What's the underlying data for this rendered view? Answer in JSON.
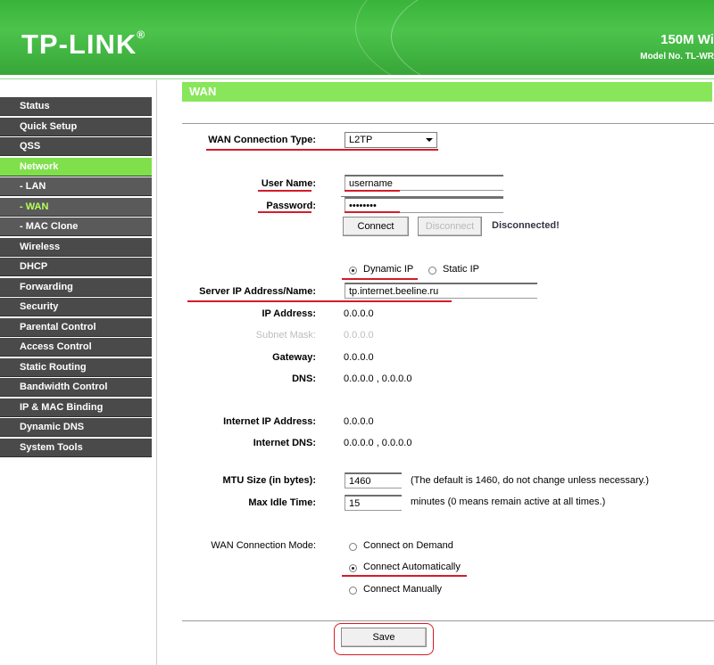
{
  "header": {
    "logo": "TP-LINK",
    "logo_mark": "®",
    "model_title": "150M Wi",
    "model_no": "Model No. TL-WR"
  },
  "sidebar": {
    "items": [
      {
        "label": "Status",
        "sub": false,
        "active": false
      },
      {
        "label": "Quick Setup",
        "sub": false,
        "active": false
      },
      {
        "label": "QSS",
        "sub": false,
        "active": false
      },
      {
        "label": "Network",
        "sub": false,
        "active": true
      },
      {
        "label": "- LAN",
        "sub": true,
        "active": false
      },
      {
        "label": "- WAN",
        "sub": true,
        "active": true
      },
      {
        "label": "- MAC Clone",
        "sub": true,
        "active": false
      },
      {
        "label": "Wireless",
        "sub": false,
        "active": false
      },
      {
        "label": "DHCP",
        "sub": false,
        "active": false
      },
      {
        "label": "Forwarding",
        "sub": false,
        "active": false
      },
      {
        "label": "Security",
        "sub": false,
        "active": false
      },
      {
        "label": "Parental Control",
        "sub": false,
        "active": false
      },
      {
        "label": "Access Control",
        "sub": false,
        "active": false
      },
      {
        "label": "Static Routing",
        "sub": false,
        "active": false
      },
      {
        "label": "Bandwidth Control",
        "sub": false,
        "active": false
      },
      {
        "label": "IP & MAC Binding",
        "sub": false,
        "active": false
      },
      {
        "label": "Dynamic DNS",
        "sub": false,
        "active": false
      },
      {
        "label": "System Tools",
        "sub": false,
        "active": false
      }
    ]
  },
  "main": {
    "section_title": "WAN",
    "wan_type_label": "WAN Connection Type:",
    "wan_type_value": "L2TP",
    "username_label": "User Name:",
    "username_value": "username",
    "password_label": "Password:",
    "password_value": "••••••••",
    "connect_label": "Connect",
    "disconnect_label": "Disconnect",
    "status_text": "Disconnected!",
    "dynamic_ip_label": "Dynamic IP",
    "static_ip_label": "Static IP",
    "ip_mode_selected": "Dynamic IP",
    "server_label": "Server IP Address/Name:",
    "server_value": "tp.internet.beeline.ru",
    "ip_address_label": "IP Address:",
    "ip_address_value": "0.0.0.0",
    "subnet_label": "Subnet Mask:",
    "subnet_value": "0.0.0.0",
    "gateway_label": "Gateway:",
    "gateway_value": "0.0.0.0",
    "dns_label": "DNS:",
    "dns_value": "0.0.0.0 , 0.0.0.0",
    "internet_ip_label": "Internet IP Address:",
    "internet_ip_value": "0.0.0.0",
    "internet_dns_label": "Internet DNS:",
    "internet_dns_value": "0.0.0.0 , 0.0.0.0",
    "mtu_label": "MTU Size (in bytes):",
    "mtu_value": "1460",
    "mtu_note": "(The default is 1460, do not change unless necessary.)",
    "idle_label": "Max Idle Time:",
    "idle_value": "15",
    "idle_note": "minutes (0 means remain active at all times.)",
    "mode_label": "WAN Connection Mode:",
    "mode_demand": "Connect on Demand",
    "mode_auto": "Connect Automatically",
    "mode_manual": "Connect Manually",
    "mode_selected": "Connect Automatically",
    "save_label": "Save"
  },
  "colors": {
    "brand_green": "#4cc44c",
    "menu_active": "#7fe04b",
    "menu_bg": "#4a4a4a",
    "annotation_red": "#d51b2a"
  }
}
